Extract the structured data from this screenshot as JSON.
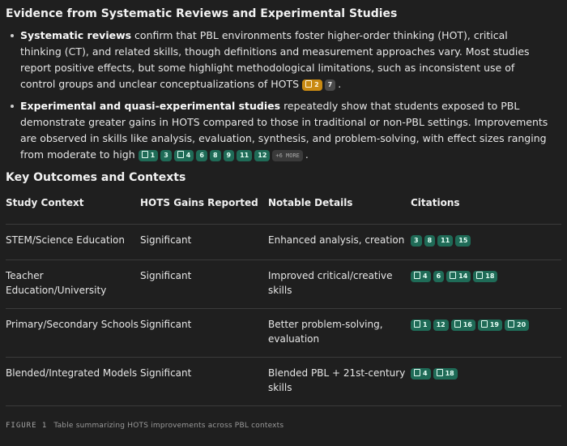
{
  "heading": "Evidence from Systematic Reviews and Experimental Studies",
  "bullets": [
    {
      "lead": "Systematic reviews",
      "text": " confirm that PBL environments foster higher-order thinking (HOT), critical thinking (CT), and related skills, though definitions and measurement approaches vary. Most studies report positive effects, but some highlight methodological limitations, such as inconsistent use of control groups and unclear conceptualizations of HOTS",
      "cites": [
        {
          "label": "2",
          "style": "gold",
          "doc": true
        },
        {
          "label": "7",
          "style": "grey",
          "doc": false
        }
      ],
      "end": "."
    },
    {
      "lead": "Experimental and quasi-experimental studies",
      "text": " repeatedly show that students exposed to PBL demonstrate greater gains in HOTS compared to those in traditional or non-PBL settings. Improvements are observed in skills like analysis, evaluation, synthesis, and problem-solving, with effect sizes ranging from moderate to high",
      "cites": [
        {
          "label": "1",
          "style": "green",
          "doc": true
        },
        {
          "label": "3",
          "style": "green",
          "doc": false
        },
        {
          "label": "4",
          "style": "green",
          "doc": true
        },
        {
          "label": "6",
          "style": "green",
          "doc": false
        },
        {
          "label": "8",
          "style": "green",
          "doc": false
        },
        {
          "label": "9",
          "style": "green",
          "doc": false
        },
        {
          "label": "11",
          "style": "green",
          "doc": false
        },
        {
          "label": "12",
          "style": "green",
          "doc": false
        },
        {
          "label": "+6 MORE",
          "style": "more",
          "doc": false
        }
      ],
      "end": "."
    }
  ],
  "subheading": "Key Outcomes and Contexts",
  "table": {
    "headers": [
      "Study Context",
      "HOTS Gains Reported",
      "Notable Details",
      "Citations"
    ],
    "rows": [
      {
        "context": "STEM/Science Education",
        "gains": "Significant",
        "details": "Enhanced analysis, creation",
        "cites": [
          {
            "label": "3",
            "doc": false
          },
          {
            "label": "8",
            "doc": false
          },
          {
            "label": "11",
            "doc": false
          },
          {
            "label": "15",
            "doc": false
          }
        ]
      },
      {
        "context": "Teacher Education/University",
        "gains": "Significant",
        "details": "Improved critical/creative skills",
        "cites": [
          {
            "label": "4",
            "doc": true
          },
          {
            "label": "6",
            "doc": false
          },
          {
            "label": "14",
            "doc": true
          },
          {
            "label": "18",
            "doc": true
          }
        ]
      },
      {
        "context": "Primary/Secondary Schools",
        "gains": "Significant",
        "details": "Better problem-solving, evaluation",
        "cites": [
          {
            "label": "1",
            "doc": true
          },
          {
            "label": "12",
            "doc": false
          },
          {
            "label": "16",
            "doc": true
          },
          {
            "label": "19",
            "doc": true
          },
          {
            "label": "20",
            "doc": true
          }
        ]
      },
      {
        "context": "Blended/Integrated Models",
        "gains": "Significant",
        "details": "Blended PBL + 21st-century skills",
        "cites": [
          {
            "label": "4",
            "doc": true
          },
          {
            "label": "18",
            "doc": true
          }
        ]
      }
    ]
  },
  "caption": {
    "label": "FIGURE 1",
    "text": "Table summarizing HOTS improvements across PBL contexts"
  }
}
